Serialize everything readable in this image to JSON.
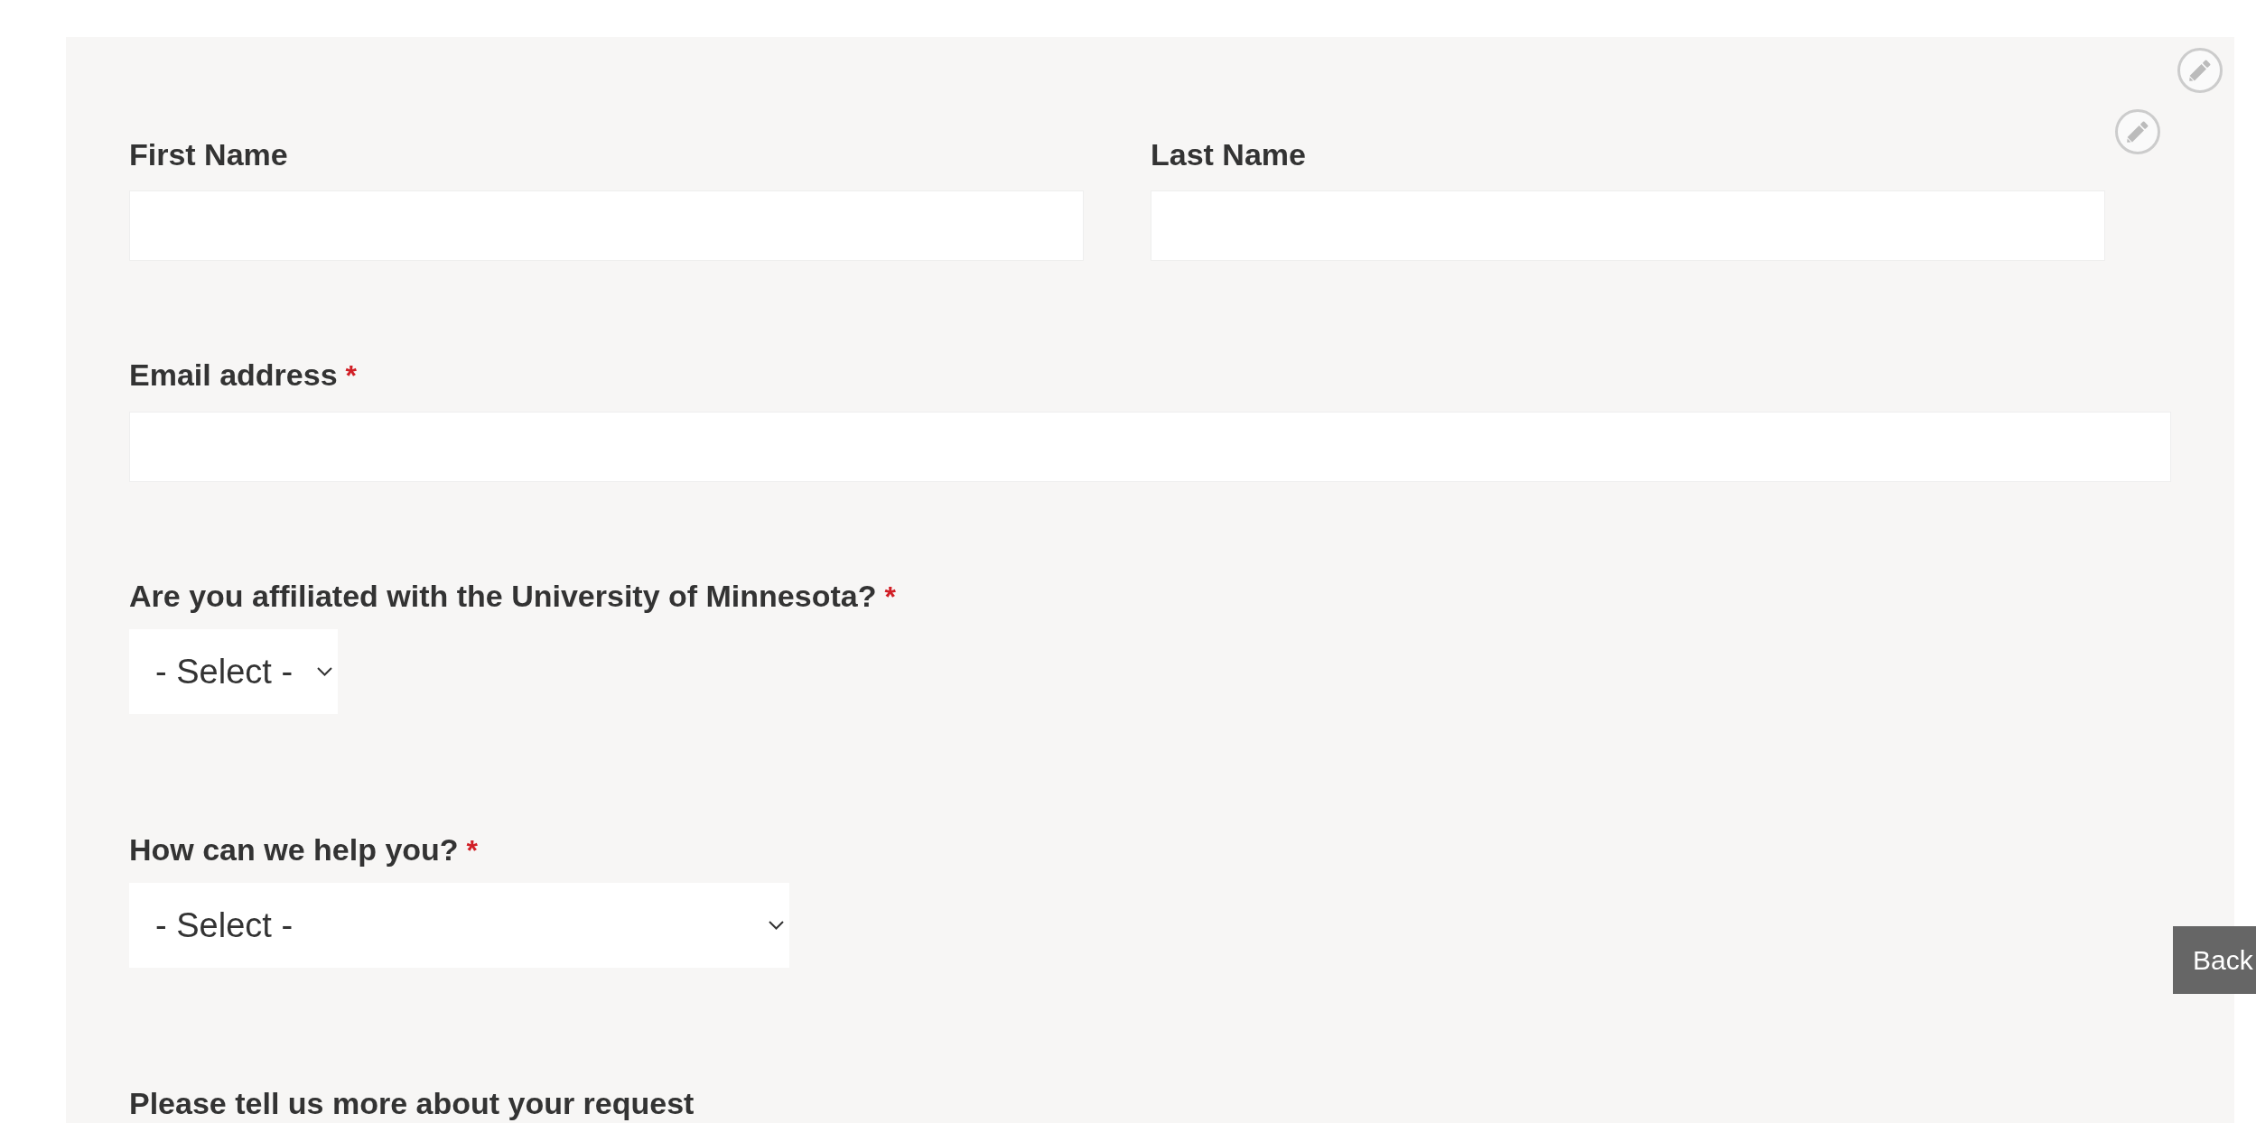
{
  "form": {
    "rows": [
      {
        "fields": [
          {
            "kind": "text",
            "label": "First Name"
          },
          {
            "kind": "text",
            "label": "Last Name"
          }
        ]
      },
      {
        "fields": [
          {
            "kind": "text",
            "label": "Email address",
            "required_mark": "*"
          }
        ]
      },
      {
        "fields": [
          {
            "kind": "select",
            "label": "Are you affiliated with the University of Minnesota?",
            "required_mark": "*",
            "value": "- Select -"
          }
        ]
      },
      {
        "fields": [
          {
            "kind": "select",
            "label": "How can we help you?",
            "required_mark": "*",
            "value": "- Select -"
          }
        ]
      },
      {
        "fields": [
          {
            "kind": "label",
            "label": "Please tell us more about your request"
          }
        ]
      }
    ]
  },
  "back_button": {
    "label": "Back"
  }
}
